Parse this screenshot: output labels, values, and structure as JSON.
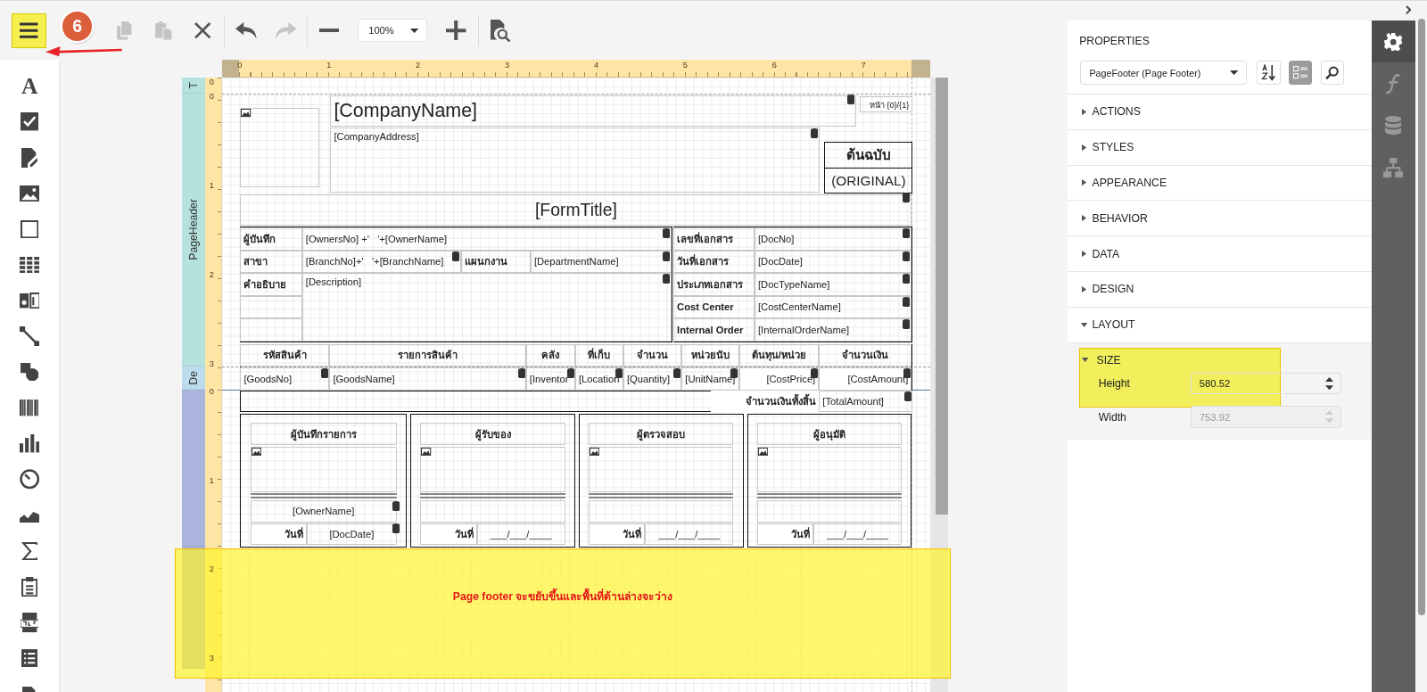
{
  "toolbar": {
    "menu_button": {
      "highlighted": true
    },
    "badge": "6",
    "edit_buttons": [
      {
        "kind": "copy",
        "disabled": true
      },
      {
        "kind": "paste",
        "disabled": true
      },
      {
        "kind": "delete",
        "disabled": false
      }
    ],
    "history_buttons": [
      {
        "kind": "undo",
        "disabled": false
      },
      {
        "kind": "redo",
        "disabled": true
      }
    ],
    "zoom": "100%"
  },
  "toolbox": {
    "text_tool_glyph": "A"
  },
  "rulers": {
    "horizontal": [
      "0",
      "1",
      "2",
      "3",
      "4",
      "5",
      "6",
      "7"
    ],
    "vertical": [
      "0",
      "0",
      "1",
      "2",
      "3",
      "0",
      "1",
      "2",
      "3"
    ]
  },
  "bands": [
    {
      "label": "T",
      "color": "#b5e2dd"
    },
    {
      "label": "PageHeader",
      "color": "#b5e2dd"
    },
    {
      "label": "De",
      "color": "#bcdcee"
    },
    {
      "color": "#aab4dc"
    },
    {
      "color": "#aab4dc"
    }
  ],
  "report": {
    "page_number": {
      "text": "หน้า {0}/{1}",
      "bound": false
    },
    "company_name": {
      "text": "[CompanyName]",
      "bound": true
    },
    "company_address": {
      "text": "[CompanyAddress]",
      "bound": true
    },
    "copy_label": "ต้นฉบับ",
    "copy_label_en": "(ORIGINAL)",
    "form_title": {
      "text": "[FormTitle]",
      "bound": true
    },
    "header_cells": [
      {
        "kind": "label",
        "text": "ผู้บันทึก"
      },
      {
        "kind": "field",
        "text": "[OwnersNo] +'   '+[OwnerName]",
        "bound": true
      },
      {
        "kind": "label",
        "text": "สาขา"
      },
      {
        "kind": "field",
        "text": "[BranchNo]+'   '+[BranchName]",
        "bound": true
      },
      {
        "kind": "label",
        "text": "แผนกงาน"
      },
      {
        "kind": "field",
        "text": "[DepartmentName]",
        "bound": true
      },
      {
        "kind": "label",
        "text": "คำอธิบาย"
      },
      {
        "kind": "field",
        "text": "[Description]",
        "bound": true
      },
      {
        "kind": "label",
        "text": "เลขที่เอกสาร"
      },
      {
        "kind": "field",
        "text": "[DocNo]",
        "bound": true
      },
      {
        "kind": "label",
        "text": "วันที่เอกสาร"
      },
      {
        "kind": "field",
        "text": "[DocDate]",
        "bound": true
      },
      {
        "kind": "label",
        "text": "ประเภทเอกสาร"
      },
      {
        "kind": "field",
        "text": "[DocTypeName]",
        "bound": true
      },
      {
        "kind": "label",
        "text": "Cost Center"
      },
      {
        "kind": "field",
        "text": "[CostCenterName]",
        "bound": true
      },
      {
        "kind": "label",
        "text": "Internal Order"
      },
      {
        "kind": "field",
        "text": "[InternalOrderName]",
        "bound": true
      }
    ],
    "table": {
      "columns": [
        "รหัสสินค้า",
        "รายการสินค้า",
        "คลัง",
        "ที่เก็บ",
        "จำนวน",
        "หน่วยนับ",
        "ต้นทุน/หน่วย",
        "จำนวนเงิน"
      ],
      "row": [
        {
          "text": "[GoodsNo]",
          "bound": true
        },
        {
          "text": "[GoodsName]",
          "bound": true
        },
        {
          "text": "[Inventor",
          "bound": true
        },
        {
          "text": "[Location",
          "bound": true
        },
        {
          "text": "[Quantity]",
          "bound": true
        },
        {
          "text": "[UnitName]",
          "bound": true
        },
        {
          "text": "[CostPrice]",
          "bound": true
        },
        {
          "text": "[CostAmount]",
          "bound": true
        }
      ],
      "total_label": "จำนวนเงินทั้งสิ้น",
      "total": {
        "text": "[TotalAmount]",
        "bound": true
      }
    },
    "signatures": [
      {
        "title": "ผู้บันทึกรายการ",
        "name": {
          "text": "[OwnerName]",
          "bound": true
        },
        "date_label": "วันที่",
        "date": {
          "text": "[DocDate]",
          "bound": true
        }
      },
      {
        "title": "ผู้รับของ",
        "date_label": "วันที่",
        "date": {
          "text": "___/___/____",
          "bound": false
        }
      },
      {
        "title": "ผู้ตรวจสอบ",
        "date_label": "วันที่",
        "date": {
          "text": "___/___/____",
          "bound": false
        }
      },
      {
        "title": "ผู้อนุมัติ",
        "date_label": "วันที่",
        "date": {
          "text": "___/___/____",
          "bound": false
        }
      }
    ],
    "footer_note": {
      "text": "Page footer จะขยับขึ้นและพื้นที่ด้านล่างจะว่าง",
      "highlighted": true
    }
  },
  "properties": {
    "title": "PROPERTIES",
    "selector": "PageFooter (Page Footer)",
    "view_buttons": [
      {
        "kind": "alphabetical",
        "selected": false
      },
      {
        "kind": "categories",
        "selected": true
      },
      {
        "kind": "search",
        "selected": false
      }
    ],
    "sections": [
      {
        "label": "ACTIONS",
        "expanded": false
      },
      {
        "label": "STYLES",
        "expanded": false
      },
      {
        "label": "APPEARANCE",
        "expanded": false
      },
      {
        "label": "BEHAVIOR",
        "expanded": false
      },
      {
        "label": "DATA",
        "expanded": false
      },
      {
        "label": "DESIGN",
        "expanded": false
      },
      {
        "label": "LAYOUT",
        "expanded": true
      }
    ],
    "group": {
      "label": "SIZE",
      "expanded": true,
      "highlighted": true
    },
    "fields": [
      {
        "label": "Height",
        "value": "580.52",
        "disabled": false
      },
      {
        "label": "Width",
        "value": "753.92",
        "disabled": true
      }
    ]
  },
  "side_tabs": [
    {
      "kind": "properties",
      "selected": true
    },
    {
      "kind": "expressions",
      "selected": false
    },
    {
      "kind": "data_source",
      "selected": false
    },
    {
      "kind": "outline",
      "selected": false
    }
  ]
}
